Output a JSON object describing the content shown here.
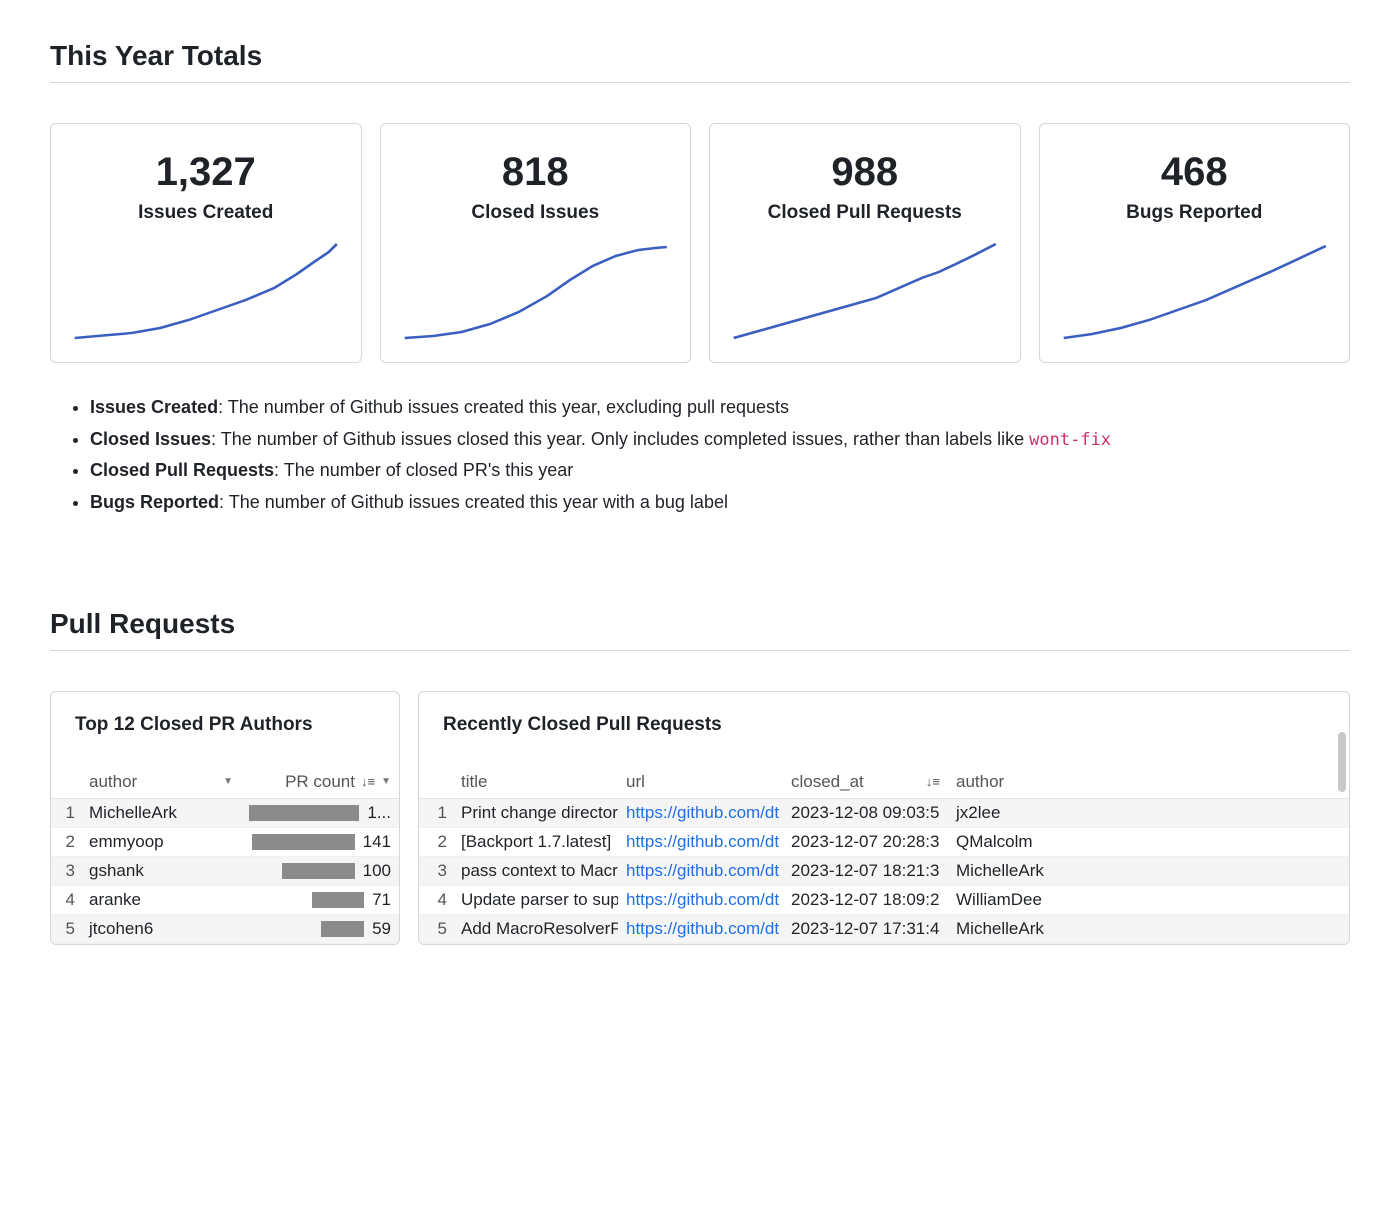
{
  "sections": {
    "totals_title": "This Year Totals",
    "pr_title": "Pull Requests"
  },
  "cards": [
    {
      "value": "1,327",
      "label": "Issues Created"
    },
    {
      "value": "818",
      "label": "Closed Issues"
    },
    {
      "value": "988",
      "label": "Closed Pull Requests"
    },
    {
      "value": "468",
      "label": "Bugs Reported"
    }
  ],
  "definitions": [
    {
      "term": "Issues Created",
      "desc": ": The number of Github issues created this year, excluding pull requests",
      "code": null
    },
    {
      "term": "Closed Issues",
      "desc": ": The number of Github issues closed this year. Only includes completed issues, rather than labels like ",
      "code": "wont-fix"
    },
    {
      "term": "Closed Pull Requests",
      "desc": ": The number of closed PR's this year",
      "code": null
    },
    {
      "term": "Bugs Reported",
      "desc": ": The number of Github issues created this year with a bug label",
      "code": null
    }
  ],
  "authors_panel": {
    "title": "Top 12 Closed PR Authors",
    "columns": {
      "author": "author",
      "count": "PR count"
    },
    "max": 150,
    "rows": [
      {
        "idx": 1,
        "author": "MichelleArk",
        "count_display": "1...",
        "count_num": 150
      },
      {
        "idx": 2,
        "author": "emmyoop",
        "count_display": "141",
        "count_num": 141
      },
      {
        "idx": 3,
        "author": "gshank",
        "count_display": "100",
        "count_num": 100
      },
      {
        "idx": 4,
        "author": "aranke",
        "count_display": "71",
        "count_num": 71
      },
      {
        "idx": 5,
        "author": "jtcohen6",
        "count_display": "59",
        "count_num": 59
      }
    ]
  },
  "recent_panel": {
    "title": "Recently Closed Pull Requests",
    "columns": {
      "title": "title",
      "url": "url",
      "closed_at": "closed_at",
      "author": "author"
    },
    "rows": [
      {
        "idx": 1,
        "title": "Print change director",
        "url": "https://github.com/dt",
        "closed_at": "2023-12-08 09:03:5",
        "author": "jx2lee"
      },
      {
        "idx": 2,
        "title": "[Backport 1.7.latest]",
        "url": "https://github.com/dt",
        "closed_at": "2023-12-07 20:28:3",
        "author": "QMalcolm"
      },
      {
        "idx": 3,
        "title": "pass context to Macr",
        "url": "https://github.com/dt",
        "closed_at": "2023-12-07 18:21:3",
        "author": "MichelleArk"
      },
      {
        "idx": 4,
        "title": "Update parser to sup",
        "url": "https://github.com/dt",
        "closed_at": "2023-12-07 18:09:2",
        "author": "WilliamDee"
      },
      {
        "idx": 5,
        "title": "Add MacroResolverP",
        "url": "https://github.com/dt",
        "closed_at": "2023-12-07 17:31:4",
        "author": "MichelleArk"
      }
    ]
  },
  "chart_data": [
    {
      "type": "line",
      "title": "Issues Created sparkline",
      "x": [
        1,
        2,
        3,
        4,
        5,
        6,
        7,
        8,
        9,
        10,
        11,
        12
      ],
      "values": [
        60,
        110,
        170,
        260,
        360,
        470,
        600,
        740,
        880,
        1030,
        1180,
        1327
      ],
      "ylim": [
        0,
        1400
      ]
    },
    {
      "type": "line",
      "title": "Closed Issues sparkline",
      "x": [
        1,
        2,
        3,
        4,
        5,
        6,
        7,
        8,
        9,
        10,
        11,
        12
      ],
      "values": [
        30,
        60,
        100,
        160,
        240,
        340,
        460,
        580,
        680,
        760,
        800,
        818
      ],
      "ylim": [
        0,
        900
      ]
    },
    {
      "type": "line",
      "title": "Closed Pull Requests sparkline",
      "x": [
        1,
        2,
        3,
        4,
        5,
        6,
        7,
        8,
        9,
        10,
        11,
        12
      ],
      "values": [
        50,
        120,
        200,
        280,
        360,
        440,
        530,
        620,
        720,
        800,
        900,
        988
      ],
      "ylim": [
        0,
        1050
      ]
    },
    {
      "type": "line",
      "title": "Bugs Reported sparkline",
      "x": [
        1,
        2,
        3,
        4,
        5,
        6,
        7,
        8,
        9,
        10,
        11,
        12
      ],
      "values": [
        20,
        40,
        70,
        110,
        160,
        210,
        260,
        310,
        360,
        400,
        440,
        468
      ],
      "ylim": [
        0,
        500
      ]
    }
  ]
}
